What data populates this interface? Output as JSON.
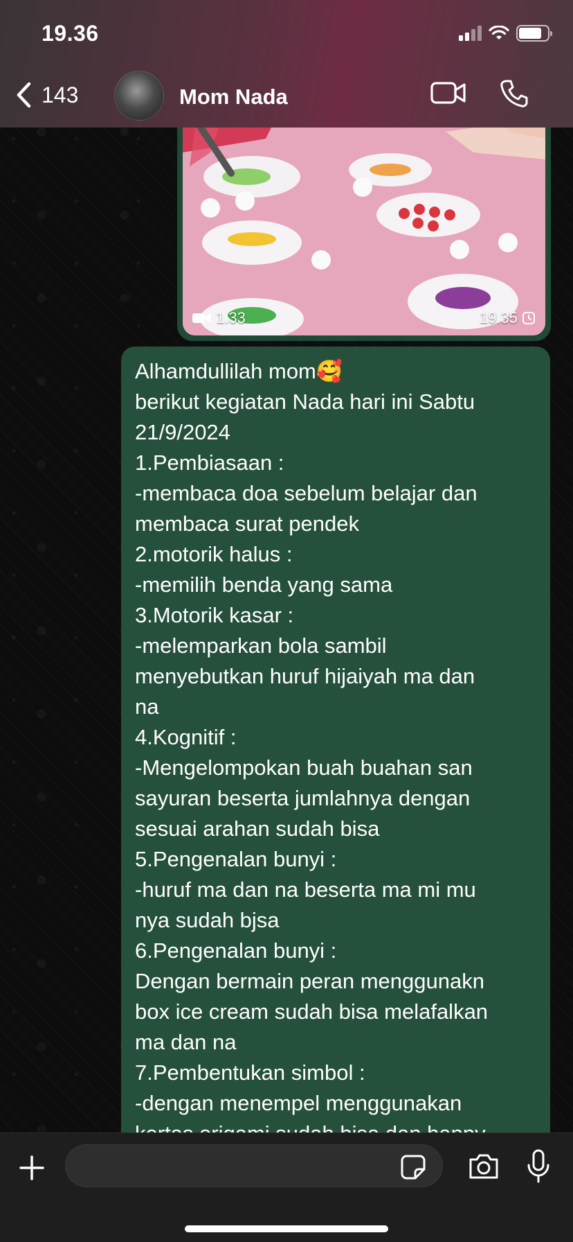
{
  "status_bar": {
    "time": "19.36",
    "signal_bars": 4,
    "signal_active": 2,
    "battery_level": 0.8
  },
  "header": {
    "back_count": "143",
    "contact_name": "Mom Nada",
    "video_call_icon": "video-camera-icon",
    "voice_call_icon": "phone-icon"
  },
  "video_message": {
    "duration": "1.33",
    "timestamp": "19.35"
  },
  "text_message": {
    "lines": [
      "Alhamdullilah mom🥰",
      "berikut kegiatan Nada hari ini Sabtu",
      "21/9/2024",
      "1.Pembiasaan :",
      "-membaca doa sebelum belajar dan",
      "membaca surat pendek",
      "2.motorik halus :",
      "-memilih benda yang sama",
      "3.Motorik kasar :",
      "-melemparkan bola sambil",
      "menyebutkan huruf hijaiyah ma dan",
      "na",
      "4.Kognitif :",
      "-Mengelompokan buah buahan san",
      "sayuran beserta jumlahnya dengan",
      "sesuai arahan sudah bisa",
      "5.Pengenalan bunyi :",
      "-huruf ma dan na beserta ma mi mu",
      "nya sudah bjsa",
      "6.Pengenalan bunyi :",
      "Dengan bermain peran menggunakn",
      "box ice cream sudah bisa melafalkan",
      "ma dan na",
      "7.Pembentukan simbol :",
      "-dengan menempel menggunakan",
      "kertas origami sudah bisa dan happy"
    ]
  },
  "composer": {
    "input_value": "",
    "icons": [
      "plus-icon",
      "sticker-icon",
      "camera-icon",
      "microphone-icon"
    ]
  },
  "colors": {
    "bubble": "#25503b",
    "header_accent": "#6e2c44",
    "composer": "#1e1e1e"
  }
}
